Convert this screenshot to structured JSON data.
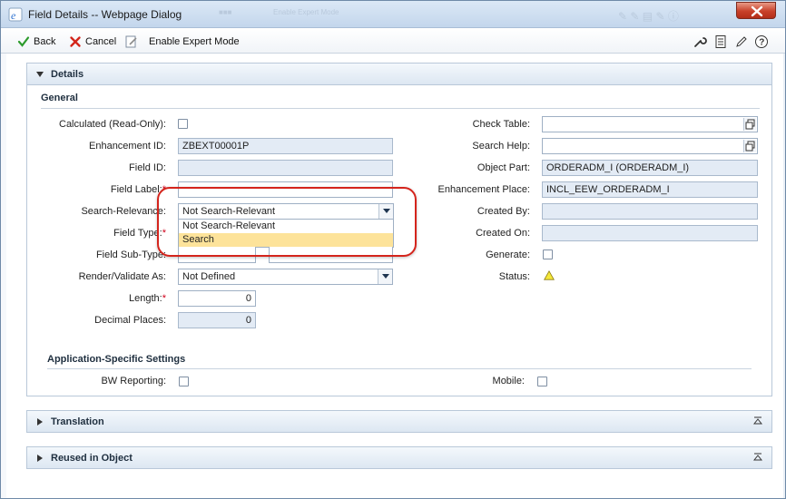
{
  "window": {
    "title": "Field Details -- Webpage Dialog",
    "ghost_text": "Enable Expert Mode"
  },
  "toolbar": {
    "back_label": "Back",
    "cancel_label": "Cancel",
    "expert_label": "Enable Expert Mode",
    "right_icons": [
      "wrench-icon",
      "document-icon",
      "pencil-icon",
      "help-icon"
    ]
  },
  "details": {
    "panel_title": "Details",
    "section_general": "General",
    "left": {
      "calculated_label": "Calculated (Read-Only):",
      "enhancement_id_label": "Enhancement ID:",
      "enhancement_id_value": "ZBEXT00001P",
      "field_id_label": "Field ID:",
      "field_id_value": "",
      "field_label_label": "Field Label:",
      "field_label_value": "",
      "search_relevance_label": "Search-Relevance:",
      "search_relevance_value": "Not Search-Relevant",
      "field_type_label": "Field Type:",
      "field_subtype_label": "Field Sub-Type:",
      "render_label": "Render/Validate As:",
      "render_value": "Not Defined",
      "length_label": "Length:",
      "length_value": "0",
      "decimal_label": "Decimal Places:",
      "decimal_value": "0"
    },
    "dropdown_options": [
      "Not Search-Relevant",
      "Search"
    ],
    "right": {
      "check_table_label": "Check Table:",
      "check_table_value": "",
      "search_help_label": "Search Help:",
      "search_help_value": "",
      "object_part_label": "Object Part:",
      "object_part_value": "ORDERADM_I (ORDERADM_I)",
      "enh_place_label": "Enhancement Place:",
      "enh_place_value": "INCL_EEW_ORDERADM_I",
      "created_by_label": "Created By:",
      "created_by_value": "",
      "created_on_label": "Created On:",
      "created_on_value": "",
      "generate_label": "Generate:",
      "status_label": "Status:"
    },
    "app_specific": {
      "title": "Application-Specific Settings",
      "bw_label": "BW Reporting:",
      "mobile_label": "Mobile:"
    }
  },
  "translation": {
    "title": "Translation"
  },
  "reused": {
    "title": "Reused in Object"
  },
  "colors": {
    "highlight": "#d4241c",
    "required": "#d0021b",
    "readonly_field": "#e3ebf5",
    "selected_option": "#fde39a"
  }
}
